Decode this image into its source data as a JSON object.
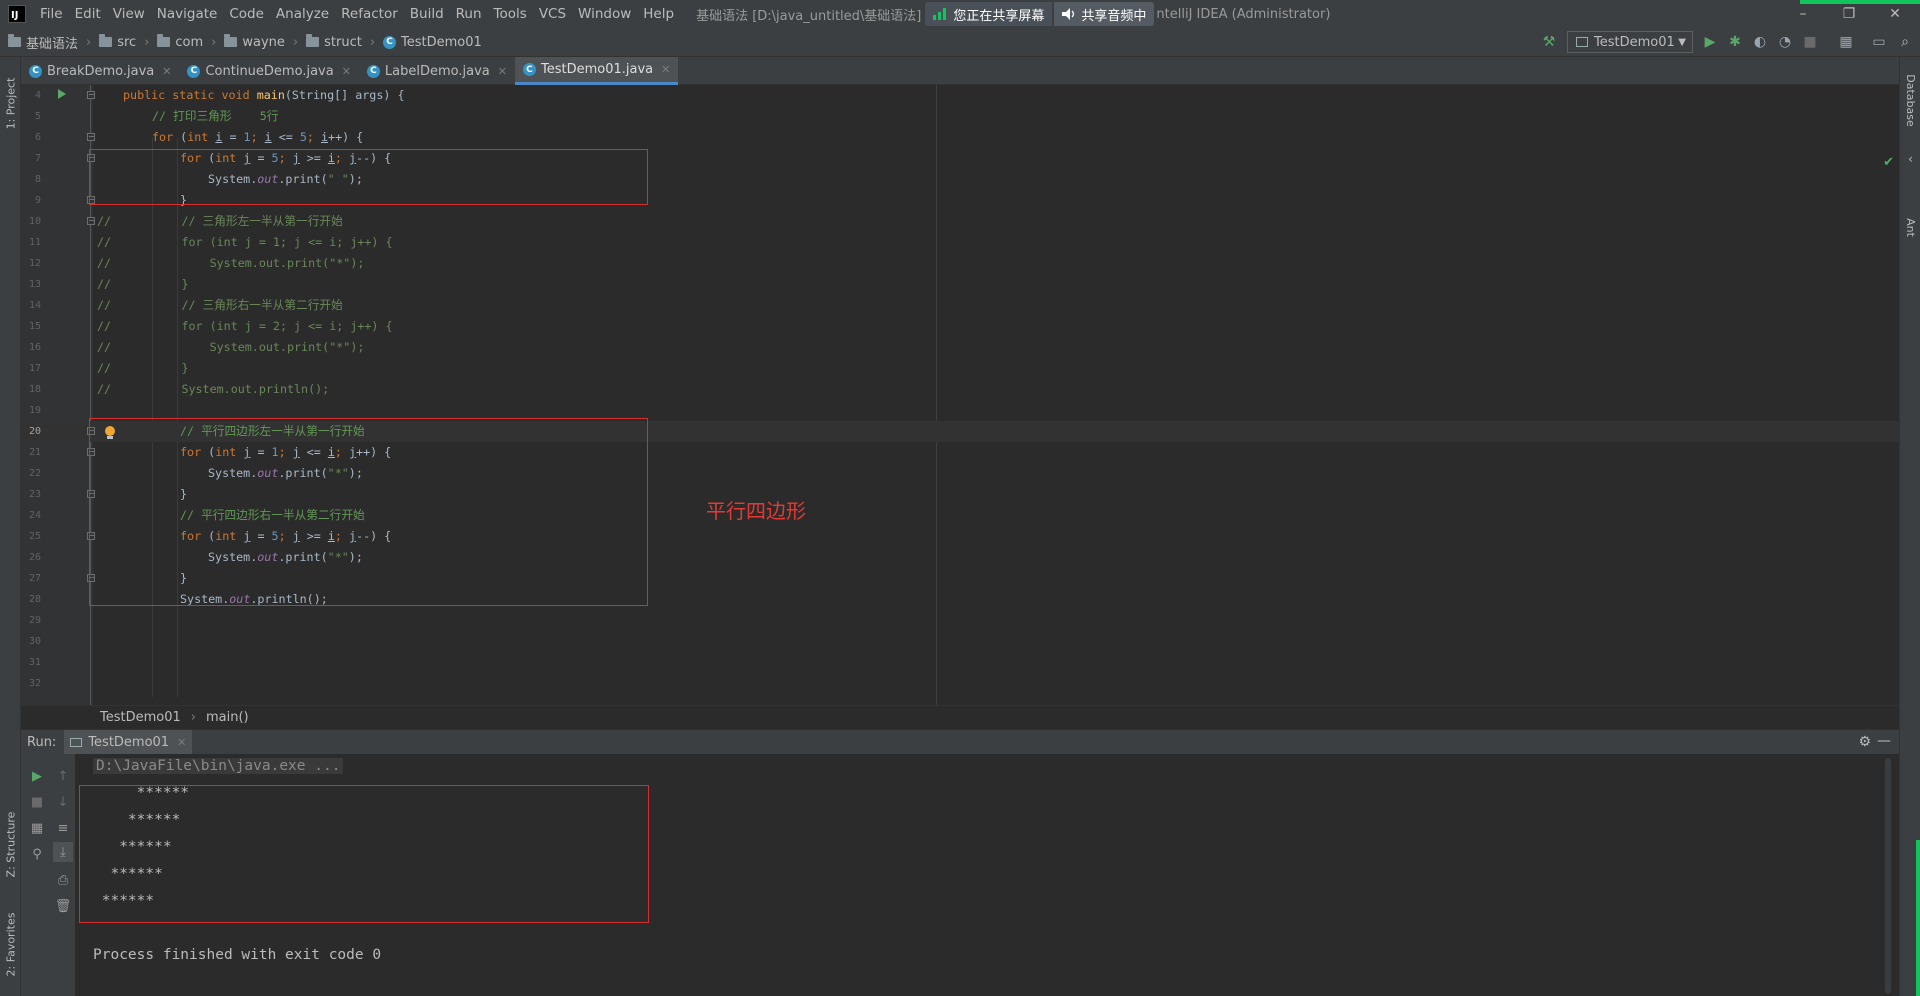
{
  "menubar": {
    "items": [
      "File",
      "Edit",
      "View",
      "Navigate",
      "Code",
      "Analyze",
      "Refactor",
      "Build",
      "Run",
      "Tools",
      "VCS",
      "Window",
      "Help"
    ],
    "title_left": "基础语法 [D:\\java_untitled\\基础语法]",
    "share_screen": "您正在共享屏幕",
    "share_audio": "共享音频中",
    "title_right": "ntelliJ IDEA (Administrator)",
    "window_controls": [
      "–",
      "❐",
      "✕"
    ]
  },
  "navbar": {
    "crumbs": [
      "基础语法",
      "src",
      "com",
      "wayne",
      "struct",
      "TestDemo01"
    ],
    "run_config": "TestDemo01"
  },
  "tool_windows": {
    "left_top": "1: Project",
    "left_structure": "Z: Structure",
    "left_favorites": "2: Favorites",
    "right_database": "Database",
    "right_ant": "Ant"
  },
  "editor_tabs": [
    {
      "label": "BreakDemo.java"
    },
    {
      "label": "ContinueDemo.java"
    },
    {
      "label": "LabelDemo.java"
    },
    {
      "label": "TestDemo01.java"
    }
  ],
  "editor": {
    "line_numbers": [
      "4",
      "5",
      "6",
      "7",
      "8",
      "9",
      "10",
      "11",
      "12",
      "13",
      "14",
      "15",
      "16",
      "17",
      "18",
      "19",
      "20",
      "21",
      "22",
      "23",
      "24",
      "25",
      "26",
      "27",
      "28",
      "29",
      "30",
      "31",
      "32"
    ],
    "code": {
      "l4_mod": "public static void ",
      "l4_fn": "main",
      "l4_rest": "(String[] args) {",
      "l5": "// 打印三角形    5行",
      "l6_kw": "for ",
      "l6_a": "(",
      "l6_int": "int ",
      "l6_b": "i",
      "l6_c": " = ",
      "l6_n1": "1",
      "l6_d": "; ",
      "l6_e": "i",
      "l6_f": " <= ",
      "l6_n2": "5",
      "l6_g": "; ",
      "l6_h": "i",
      "l6_i": "++) {",
      "l7_kw": "for ",
      "l7_a": "(",
      "l7_int": "int ",
      "l7_b": "j",
      "l7_c": " = ",
      "l7_n1": "5",
      "l7_d": "; ",
      "l7_e": "j",
      "l7_f": " >= ",
      "l7_g": "i",
      "l7_h": "; ",
      "l7_i": "j",
      "l7_j": "--) {",
      "l8_a": "System.",
      "l8_out": "out",
      "l8_b": ".print(",
      "l8_str": "\" \"",
      "l8_c": ");",
      "l9": "}",
      "l10": "//          // 三角形左一半从第一行开始",
      "l11": "//          for (int j = 1; j <= i; j++) {",
      "l12": "//              System.out.print(\"*\");",
      "l13": "//          }",
      "l14": "//          // 三角形右一半从第二行开始",
      "l15": "//          for (int j = 2; j <= i; j++) {",
      "l16": "//              System.out.print(\"*\");",
      "l17": "//          }",
      "l18": "//          System.out.println();",
      "l20": "// 平行四边形左一半从第一行开始",
      "l21_kw": "for ",
      "l21_a": "(",
      "l21_int": "int ",
      "l21_b": "j",
      "l21_c": " = ",
      "l21_n1": "1",
      "l21_d": "; ",
      "l21_e": "j",
      "l21_f": " <= ",
      "l21_g": "i",
      "l21_h": "; ",
      "l21_i": "j",
      "l21_j": "++) {",
      "l22_a": "System.",
      "l22_out": "out",
      "l22_b": ".print(",
      "l22_str": "\"*\"",
      "l22_c": ");",
      "l23": "}",
      "l24": "// 平行四边形右一半从第二行开始",
      "l25_kw": "for ",
      "l25_a": "(",
      "l25_int": "int ",
      "l25_b": "j",
      "l25_c": " = ",
      "l25_n1": "5",
      "l25_d": "; ",
      "l25_e": "j",
      "l25_f": " >= ",
      "l25_g": "i",
      "l25_h": "; ",
      "l25_i": "j",
      "l25_j": "--) {",
      "l26_a": "System.",
      "l26_out": "out",
      "l26_b": ".print(",
      "l26_str": "\"*\"",
      "l26_c": ");",
      "l27": "}",
      "l28_a": "System.",
      "l28_out": "out",
      "l28_b": ".println();"
    },
    "annotation_label": "平行四边形"
  },
  "editor_breadcrumb": [
    "TestDemo01",
    "main()"
  ],
  "run_panel": {
    "label": "Run:",
    "tab": "TestDemo01",
    "command": "D:\\JavaFile\\bin\\java.exe ...",
    "output_lines": [
      "     ******",
      "    ******",
      "   ******",
      "  ******",
      " ******"
    ],
    "exit_message": "Process finished with exit code 0"
  },
  "colors": {
    "accent_tab": "#4a88c7",
    "annotation": "#d32f2f",
    "share_green": "#10c55b"
  }
}
